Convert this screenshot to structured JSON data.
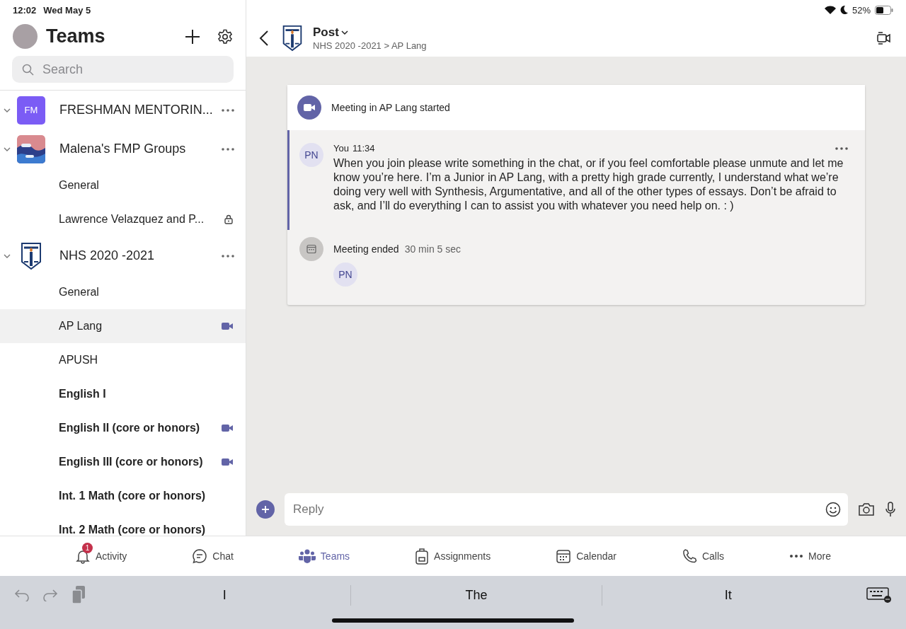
{
  "status_bar": {
    "time": "12:02",
    "date": "Wed May 5",
    "battery": "52%"
  },
  "sidebar": {
    "title": "Teams",
    "search": {
      "placeholder": "Search"
    },
    "teams": [
      {
        "name": "FRESHMAN MENTORIN...",
        "kind": "initials",
        "initials": "FM",
        "expanded": true
      },
      {
        "name": "Malena's FMP Groups",
        "kind": "image",
        "expanded": true,
        "channels": [
          {
            "name": "General",
            "selected": false,
            "unread": false,
            "meeting": false,
            "private": false
          },
          {
            "name": "Lawrence Velazquez and P...",
            "selected": false,
            "unread": false,
            "meeting": false,
            "private": true
          }
        ]
      },
      {
        "name": "NHS 2020 -2021",
        "kind": "crest",
        "expanded": true,
        "channels": [
          {
            "name": "General",
            "selected": false,
            "unread": false,
            "meeting": false,
            "private": false
          },
          {
            "name": "AP Lang",
            "selected": true,
            "unread": false,
            "meeting": true,
            "private": false
          },
          {
            "name": "APUSH",
            "selected": false,
            "unread": false,
            "meeting": false,
            "private": false
          },
          {
            "name": "English I",
            "selected": false,
            "unread": true,
            "meeting": false,
            "private": false
          },
          {
            "name": "English II (core or honors)",
            "selected": false,
            "unread": true,
            "meeting": true,
            "private": false
          },
          {
            "name": "English III (core or honors)",
            "selected": false,
            "unread": true,
            "meeting": true,
            "private": false
          },
          {
            "name": "Int. 1 Math (core or honors)",
            "selected": false,
            "unread": true,
            "meeting": false,
            "private": false
          },
          {
            "name": "Int. 2 Math (core or honors)",
            "selected": false,
            "unread": true,
            "meeting": false,
            "private": false
          }
        ]
      }
    ]
  },
  "conversation": {
    "title": "Post",
    "breadcrumb": "NHS 2020 -2021 > AP Lang",
    "meeting_started": "Meeting in AP Lang started",
    "post": {
      "initials": "PN",
      "author": "You",
      "time": "11:34",
      "body": "When you join please write something in the chat, or if you feel comfortable please unmute and let me know you’re here. I’m a Junior in AP Lang, with a pretty high grade currently, I understand what we’re doing very well with Synthesis, Argumentative, and all of the other types of essays. Don’t be afraid to ask, and I’ll do everything I can to assist you with whatever you need help on. : )"
    },
    "meeting_ended": {
      "label": "Meeting ended",
      "duration": "30 min 5 sec",
      "participants": [
        "PN"
      ]
    },
    "reply": {
      "placeholder": "Reply"
    }
  },
  "tabs": [
    {
      "kind": "activity",
      "label": "Activity",
      "selected": false,
      "badge": "1"
    },
    {
      "kind": "chat",
      "label": "Chat",
      "selected": false
    },
    {
      "kind": "teams",
      "label": "Teams",
      "selected": true
    },
    {
      "kind": "assignments",
      "label": "Assignments",
      "selected": false
    },
    {
      "kind": "calendar",
      "label": "Calendar",
      "selected": false
    },
    {
      "kind": "calls",
      "label": "Calls",
      "selected": false
    },
    {
      "kind": "more",
      "label": "More",
      "selected": false
    }
  ],
  "keyboard": {
    "suggestions": [
      "I",
      "The",
      "It"
    ]
  }
}
